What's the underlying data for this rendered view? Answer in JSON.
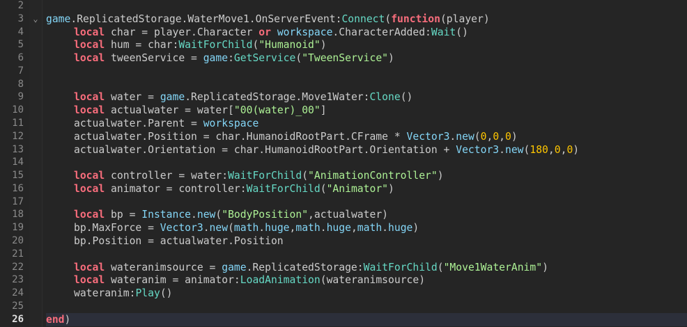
{
  "colors": {
    "background": "#252525",
    "keyword": "#f86d7c",
    "global": "#84d6f7",
    "method": "#66d9c5",
    "string": "#adf195",
    "number": "#ffc600",
    "text": "#cccccc",
    "current_line": "#2c2f3a"
  },
  "fold_icon": "chevron-down-icon",
  "current_line": "26",
  "lines": [
    {
      "num": "2",
      "indent": 0,
      "tokens": []
    },
    {
      "num": "3",
      "indent": 0,
      "fold": "⌄",
      "tokens": [
        [
          "g",
          "game"
        ],
        [
          "t",
          ".ReplicatedStorage.WaterMove1.OnServerEvent:"
        ],
        [
          "m",
          "Connect"
        ],
        [
          "t",
          "("
        ],
        [
          "k",
          "function"
        ],
        [
          "t",
          "(player)"
        ]
      ]
    },
    {
      "num": "4",
      "indent": 1,
      "tokens": [
        [
          "k",
          "local"
        ],
        [
          "t",
          " char = player.Character "
        ],
        [
          "k",
          "or"
        ],
        [
          "t",
          " "
        ],
        [
          "g",
          "workspace"
        ],
        [
          "t",
          ".CharacterAdded:"
        ],
        [
          "m",
          "Wait"
        ],
        [
          "t",
          "()"
        ]
      ]
    },
    {
      "num": "5",
      "indent": 1,
      "tokens": [
        [
          "k",
          "local"
        ],
        [
          "t",
          " hum = char:"
        ],
        [
          "m",
          "WaitForChild"
        ],
        [
          "t",
          "("
        ],
        [
          "s",
          "\"Humanoid\""
        ],
        [
          "t",
          ")"
        ]
      ]
    },
    {
      "num": "6",
      "indent": 1,
      "tokens": [
        [
          "k",
          "local"
        ],
        [
          "t",
          " tweenService = "
        ],
        [
          "g",
          "game"
        ],
        [
          "t",
          ":"
        ],
        [
          "m",
          "GetService"
        ],
        [
          "t",
          "("
        ],
        [
          "s",
          "\"TweenService\""
        ],
        [
          "t",
          ")"
        ]
      ]
    },
    {
      "num": "7",
      "indent": 0,
      "tokens": []
    },
    {
      "num": "8",
      "indent": 0,
      "tokens": []
    },
    {
      "num": "9",
      "indent": 1,
      "tokens": [
        [
          "k",
          "local"
        ],
        [
          "t",
          " water = "
        ],
        [
          "g",
          "game"
        ],
        [
          "t",
          ".ReplicatedStorage.Move1Water:"
        ],
        [
          "m",
          "Clone"
        ],
        [
          "t",
          "()"
        ]
      ]
    },
    {
      "num": "10",
      "indent": 1,
      "tokens": [
        [
          "k",
          "local"
        ],
        [
          "t",
          " actualwater = water["
        ],
        [
          "s",
          "\"00(water)_00\""
        ],
        [
          "t",
          "]"
        ]
      ]
    },
    {
      "num": "11",
      "indent": 1,
      "tokens": [
        [
          "t",
          "actualwater.Parent = "
        ],
        [
          "g",
          "workspace"
        ]
      ]
    },
    {
      "num": "12",
      "indent": 1,
      "tokens": [
        [
          "t",
          "actualwater.Position = char.HumanoidRootPart.CFrame * "
        ],
        [
          "g",
          "Vector3"
        ],
        [
          "t",
          "."
        ],
        [
          "g",
          "new"
        ],
        [
          "t",
          "("
        ],
        [
          "n",
          "0"
        ],
        [
          "t",
          ","
        ],
        [
          "n",
          "0"
        ],
        [
          "t",
          ","
        ],
        [
          "n",
          "0"
        ],
        [
          "t",
          ")"
        ]
      ]
    },
    {
      "num": "13",
      "indent": 1,
      "tokens": [
        [
          "t",
          "actualwater.Orientation = char.HumanoidRootPart.Orientation + "
        ],
        [
          "g",
          "Vector3"
        ],
        [
          "t",
          "."
        ],
        [
          "g",
          "new"
        ],
        [
          "t",
          "("
        ],
        [
          "n",
          "180"
        ],
        [
          "t",
          ","
        ],
        [
          "n",
          "0"
        ],
        [
          "t",
          ","
        ],
        [
          "n",
          "0"
        ],
        [
          "t",
          ")"
        ]
      ]
    },
    {
      "num": "14",
      "indent": 0,
      "tokens": []
    },
    {
      "num": "15",
      "indent": 1,
      "tokens": [
        [
          "k",
          "local"
        ],
        [
          "t",
          " controller = water:"
        ],
        [
          "m",
          "WaitForChild"
        ],
        [
          "t",
          "("
        ],
        [
          "s",
          "\"AnimationController\""
        ],
        [
          "t",
          ")"
        ]
      ]
    },
    {
      "num": "16",
      "indent": 1,
      "tokens": [
        [
          "k",
          "local"
        ],
        [
          "t",
          " animator = controller:"
        ],
        [
          "m",
          "WaitForChild"
        ],
        [
          "t",
          "("
        ],
        [
          "s",
          "\"Animator\""
        ],
        [
          "t",
          ")"
        ]
      ]
    },
    {
      "num": "17",
      "indent": 0,
      "tokens": []
    },
    {
      "num": "18",
      "indent": 1,
      "tokens": [
        [
          "k",
          "local"
        ],
        [
          "t",
          " bp = "
        ],
        [
          "g",
          "Instance"
        ],
        [
          "t",
          "."
        ],
        [
          "g",
          "new"
        ],
        [
          "t",
          "("
        ],
        [
          "s",
          "\"BodyPosition\""
        ],
        [
          "t",
          ",actualwater)"
        ]
      ]
    },
    {
      "num": "19",
      "indent": 1,
      "tokens": [
        [
          "t",
          "bp.MaxForce = "
        ],
        [
          "g",
          "Vector3"
        ],
        [
          "t",
          "."
        ],
        [
          "g",
          "new"
        ],
        [
          "t",
          "("
        ],
        [
          "g",
          "math"
        ],
        [
          "t",
          "."
        ],
        [
          "g",
          "huge"
        ],
        [
          "t",
          ","
        ],
        [
          "g",
          "math"
        ],
        [
          "t",
          "."
        ],
        [
          "g",
          "huge"
        ],
        [
          "t",
          ","
        ],
        [
          "g",
          "math"
        ],
        [
          "t",
          "."
        ],
        [
          "g",
          "huge"
        ],
        [
          "t",
          ")"
        ]
      ]
    },
    {
      "num": "20",
      "indent": 1,
      "tokens": [
        [
          "t",
          "bp.Position = actualwater.Position"
        ]
      ]
    },
    {
      "num": "21",
      "indent": 0,
      "tokens": []
    },
    {
      "num": "22",
      "indent": 1,
      "tokens": [
        [
          "k",
          "local"
        ],
        [
          "t",
          " wateranimsource = "
        ],
        [
          "g",
          "game"
        ],
        [
          "t",
          ".ReplicatedStorage:"
        ],
        [
          "m",
          "WaitForChild"
        ],
        [
          "t",
          "("
        ],
        [
          "s",
          "\"Move1WaterAnim\""
        ],
        [
          "t",
          ")"
        ]
      ]
    },
    {
      "num": "23",
      "indent": 1,
      "tokens": [
        [
          "k",
          "local"
        ],
        [
          "t",
          " wateranim = animator:"
        ],
        [
          "m",
          "LoadAnimation"
        ],
        [
          "t",
          "(wateranimsource)"
        ]
      ]
    },
    {
      "num": "24",
      "indent": 1,
      "tokens": [
        [
          "t",
          "wateranim:"
        ],
        [
          "m",
          "Play"
        ],
        [
          "t",
          "()"
        ]
      ]
    },
    {
      "num": "25",
      "indent": 0,
      "tokens": []
    },
    {
      "num": "26",
      "indent": 0,
      "tokens": [
        [
          "k",
          "end"
        ],
        [
          "t",
          ")"
        ]
      ]
    }
  ]
}
